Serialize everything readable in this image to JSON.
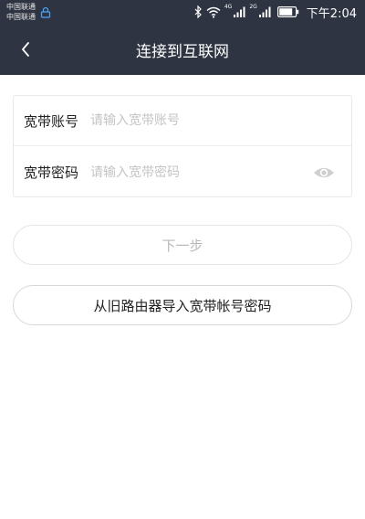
{
  "status_bar": {
    "carrier_1": "中国联通",
    "carrier_2": "中国联通",
    "net_tag_1": "4G",
    "net_tag_2": "2G",
    "time": "下午2:04",
    "icons": [
      "bluetooth-icon",
      "wifi-icon",
      "signal-icon",
      "battery-icon"
    ]
  },
  "nav": {
    "back_icon": "chevron-left-icon",
    "title": "连接到互联网"
  },
  "form": {
    "account_label": "宽带账号",
    "account_placeholder": "请输入宽带账号",
    "account_value": "",
    "password_label": "宽带密码",
    "password_placeholder": "请输入宽带密码",
    "password_value": "",
    "toggle_icon": "eye-icon"
  },
  "actions": {
    "next_label": "下一步",
    "import_label": "从旧路由器导入宽带帐号密码"
  },
  "colors": {
    "header_bg": "#2f3442",
    "disabled_text": "#b9b9b9",
    "placeholder": "#c4c4c4"
  }
}
